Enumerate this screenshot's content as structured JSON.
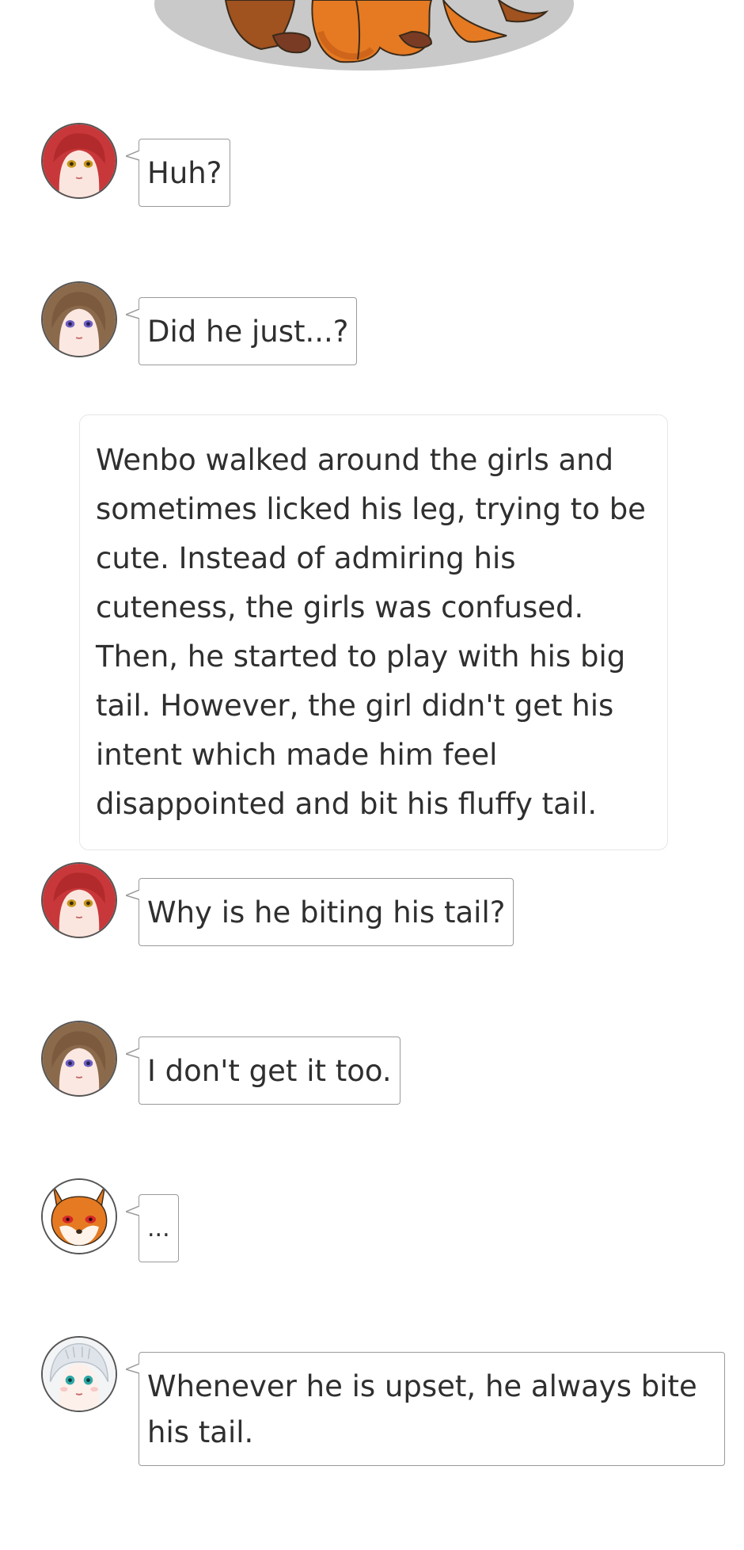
{
  "story": {
    "scene_image": "fox-sitting-on-shadow",
    "messages": [
      {
        "speaker": "red-haired-girl",
        "avatar": "red-haired-girl-avatar-icon",
        "text": "Huh?"
      },
      {
        "speaker": "brown-haired-girl",
        "avatar": "brown-haired-girl-avatar-icon",
        "text": "Did he just...?"
      },
      {
        "speaker": "red-haired-girl",
        "avatar": "red-haired-girl-avatar-icon",
        "text": "Why is he biting his tail?"
      },
      {
        "speaker": "brown-haired-girl",
        "avatar": "brown-haired-girl-avatar-icon",
        "text": "I don't get it too."
      },
      {
        "speaker": "fox",
        "avatar": "fox-avatar-icon",
        "text": "..."
      },
      {
        "speaker": "white-haired-girl",
        "avatar": "white-haired-girl-avatar-icon",
        "text": "Whenever he is upset, he always bite his tail."
      }
    ],
    "narration": "Wenbo walked around the girls and sometimes licked his leg, trying to be cute. Instead of admiring his cuteness, the girls was confused. Then, he started to play with his big tail. However, the girl didn't get his intent which made him feel disappointed and bit his fluffy tail."
  },
  "colors": {
    "bubble_border": "#9a9a9a",
    "narration_border": "#e6e6e6",
    "fox_orange": "#e57a22",
    "shadow_gray": "#c8c8c8"
  }
}
